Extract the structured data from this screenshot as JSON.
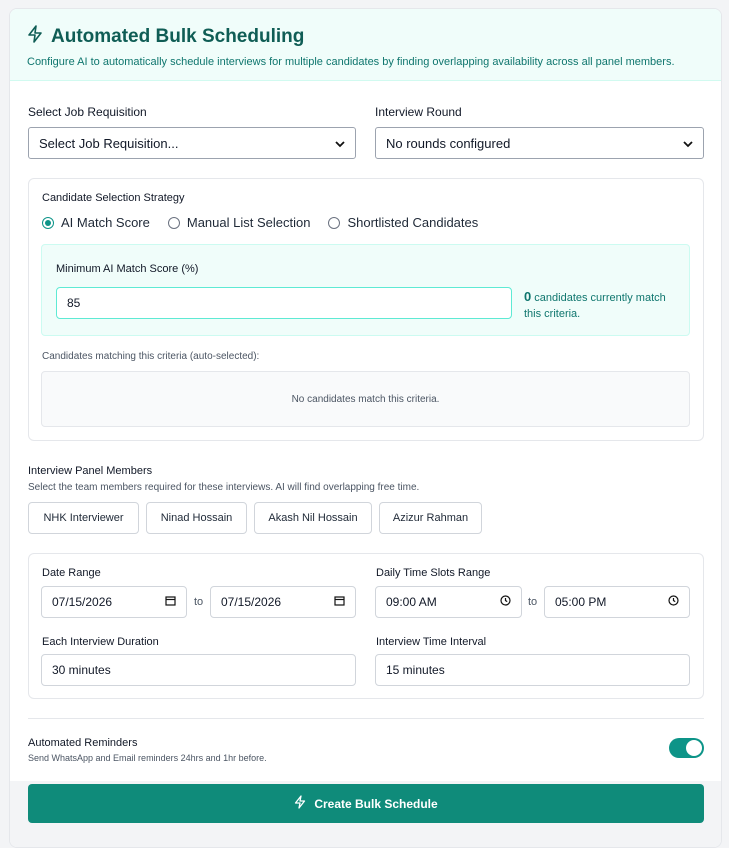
{
  "header": {
    "title": "Automated Bulk Scheduling",
    "subtitle": "Configure AI to automatically schedule interviews for multiple candidates by finding overlapping availability across all panel members."
  },
  "job": {
    "label": "Select Job Requisition",
    "value": "Select Job Requisition..."
  },
  "round": {
    "label": "Interview Round",
    "value": "No rounds configured"
  },
  "strategy": {
    "label": "Candidate Selection Strategy",
    "options": [
      {
        "label": "AI Match Score",
        "checked": true
      },
      {
        "label": "Manual List Selection",
        "checked": false
      },
      {
        "label": "Shortlisted Candidates",
        "checked": false
      }
    ],
    "min_score_label": "Minimum AI Match Score (%)",
    "min_score_value": "85",
    "match_count": "0",
    "match_text": "candidates currently match this criteria.",
    "matching_label": "Candidates matching this criteria (auto-selected):",
    "empty_text": "No candidates match this criteria."
  },
  "panel": {
    "label": "Interview Panel Members",
    "hint": "Select the team members required for these interviews. AI will find overlapping free time.",
    "members": [
      "NHK Interviewer",
      "Ninad Hossain",
      "Akash Nil Hossain",
      "Azizur Rahman"
    ]
  },
  "schedule": {
    "date_range_label": "Date Range",
    "date_from": "07/15/2026",
    "date_to": "07/15/2026",
    "to_label": "to",
    "time_range_label": "Daily Time Slots Range",
    "time_from": "09:00 AM",
    "time_to": "05:00 PM",
    "duration_label": "Each Interview Duration",
    "duration_value": "30 minutes",
    "interval_label": "Interview Time Interval",
    "interval_value": "15 minutes"
  },
  "reminders": {
    "label": "Automated Reminders",
    "hint": "Send WhatsApp and Email reminders 24hrs and 1hr before.",
    "enabled": true
  },
  "cta": {
    "label": "Create Bulk Schedule"
  },
  "colors": {
    "accent": "#0d9488",
    "title": "#0f5d55",
    "button": "#0f8b7a"
  }
}
